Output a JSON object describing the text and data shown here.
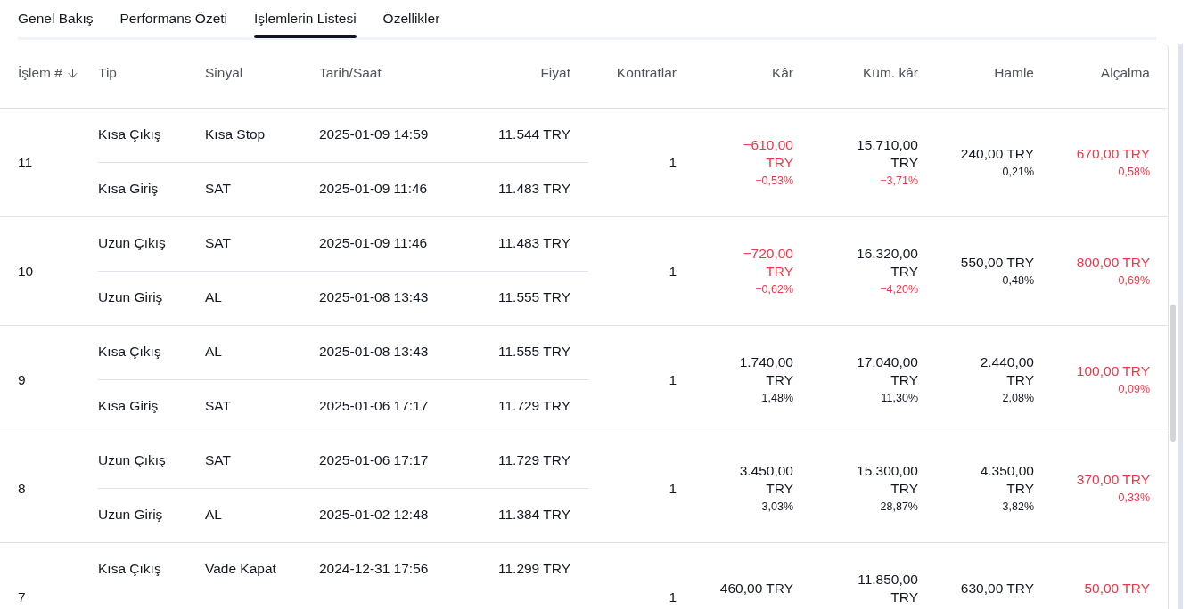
{
  "tabs": [
    {
      "label": "Genel Bakış",
      "selected": false
    },
    {
      "label": "Performans Özeti",
      "selected": false
    },
    {
      "label": "İşlemlerin Listesi",
      "selected": true
    },
    {
      "label": "Özellikler",
      "selected": false
    }
  ],
  "table": {
    "columns": [
      "İşlem #",
      "Tip",
      "Sinyal",
      "Tarih/Saat",
      "Fiyat",
      "Kontratlar",
      "Kâr",
      "Küm. kâr",
      "Hamle",
      "Alçalma"
    ],
    "rows": [
      {
        "number": "11",
        "legs": [
          {
            "type": "Kısa Çıkış",
            "signal": "Kısa Stop",
            "datetime": "2025-01-09 14:59",
            "price": "11.544 TRY"
          },
          {
            "type": "Kısa Giriş",
            "signal": "SAT",
            "datetime": "2025-01-09 11:46",
            "price": "11.483 TRY"
          }
        ],
        "contracts": "1",
        "profit": {
          "value": "−610,00 TRY",
          "value_loss": true,
          "percent": "−0,53%",
          "percent_loss": true
        },
        "cum_profit": {
          "value": "15.710,00 TRY",
          "value_loss": false,
          "percent": "−3,71%",
          "percent_loss": true
        },
        "run_up": {
          "value": "240,00 TRY",
          "value_loss": false,
          "percent": "0,21%",
          "percent_loss": false
        },
        "drawdown": {
          "value": "670,00 TRY",
          "value_loss": true,
          "percent": "0,58%",
          "percent_loss": true
        }
      },
      {
        "number": "10",
        "legs": [
          {
            "type": "Uzun Çıkış",
            "signal": "SAT",
            "datetime": "2025-01-09 11:46",
            "price": "11.483 TRY"
          },
          {
            "type": "Uzun Giriş",
            "signal": "AL",
            "datetime": "2025-01-08 13:43",
            "price": "11.555 TRY"
          }
        ],
        "contracts": "1",
        "profit": {
          "value": "−720,00 TRY",
          "value_loss": true,
          "percent": "−0,62%",
          "percent_loss": true
        },
        "cum_profit": {
          "value": "16.320,00 TRY",
          "value_loss": false,
          "percent": "−4,20%",
          "percent_loss": true
        },
        "run_up": {
          "value": "550,00 TRY",
          "value_loss": false,
          "percent": "0,48%",
          "percent_loss": false
        },
        "drawdown": {
          "value": "800,00 TRY",
          "value_loss": true,
          "percent": "0,69%",
          "percent_loss": true
        }
      },
      {
        "number": "9",
        "legs": [
          {
            "type": "Kısa Çıkış",
            "signal": "AL",
            "datetime": "2025-01-08 13:43",
            "price": "11.555 TRY"
          },
          {
            "type": "Kısa Giriş",
            "signal": "SAT",
            "datetime": "2025-01-06 17:17",
            "price": "11.729 TRY"
          }
        ],
        "contracts": "1",
        "profit": {
          "value": "1.740,00 TRY",
          "value_loss": false,
          "percent": "1,48%",
          "percent_loss": false
        },
        "cum_profit": {
          "value": "17.040,00 TRY",
          "value_loss": false,
          "percent": "11,30%",
          "percent_loss": false
        },
        "run_up": {
          "value": "2.440,00 TRY",
          "value_loss": false,
          "percent": "2,08%",
          "percent_loss": false
        },
        "drawdown": {
          "value": "100,00 TRY",
          "value_loss": true,
          "percent": "0,09%",
          "percent_loss": true
        }
      },
      {
        "number": "8",
        "legs": [
          {
            "type": "Uzun Çıkış",
            "signal": "SAT",
            "datetime": "2025-01-06 17:17",
            "price": "11.729 TRY"
          },
          {
            "type": "Uzun Giriş",
            "signal": "AL",
            "datetime": "2025-01-02 12:48",
            "price": "11.384 TRY"
          }
        ],
        "contracts": "1",
        "profit": {
          "value": "3.450,00 TRY",
          "value_loss": false,
          "percent": "3,03%",
          "percent_loss": false
        },
        "cum_profit": {
          "value": "15.300,00 TRY",
          "value_loss": false,
          "percent": "28,87%",
          "percent_loss": false
        },
        "run_up": {
          "value": "4.350,00 TRY",
          "value_loss": false,
          "percent": "3,82%",
          "percent_loss": false
        },
        "drawdown": {
          "value": "370,00 TRY",
          "value_loss": true,
          "percent": "0,33%",
          "percent_loss": true
        }
      },
      {
        "number": "7",
        "legs": [
          {
            "type": "Kısa Çıkış",
            "signal": "Vade Kapat",
            "datetime": "2024-12-31 17:56",
            "price": "11.299 TRY"
          }
        ],
        "contracts": "1",
        "profit": {
          "value": "460,00 TRY",
          "value_loss": false
        },
        "cum_profit": {
          "value": "11.850,00 TRY",
          "value_loss": false
        },
        "run_up": {
          "value": "630,00 TRY",
          "value_loss": false
        },
        "drawdown": {
          "value": "50,00 TRY",
          "value_loss": true
        }
      }
    ]
  }
}
